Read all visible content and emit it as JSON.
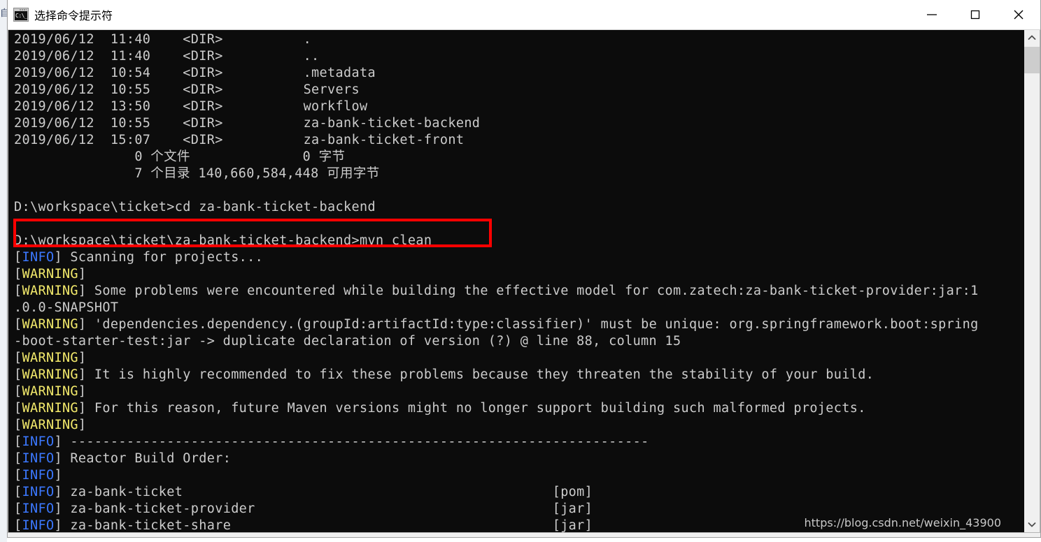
{
  "desktop": {
    "edge_text": "自"
  },
  "window": {
    "title": "选择命令提示符",
    "icon": "cmd-prompt-icon",
    "icon_glyph": "C:\\_",
    "controls": {
      "minimize": "minimize-icon",
      "maximize": "maximize-icon",
      "close": "close-icon"
    }
  },
  "colors": {
    "terminal_bg": "#0c0c0c",
    "terminal_fg": "#cccccc",
    "info_blue": "#3b78ff",
    "warning_yellow": "#f2e96b",
    "annotation_red": "#ff0000",
    "titlebar_bg": "#ffffff",
    "window_chrome": "#f0f0f0"
  },
  "annotation": {
    "type": "red-rectangle-highlight",
    "highlighted_line": "D:\\workspace\\ticket\\za-bank-ticket-backend>mvn clean"
  },
  "watermark": {
    "text": "https://blog.csdn.net/weixin_43900"
  },
  "scrollbar": {
    "up_arrow": "chevron-up-icon",
    "down_arrow": "chevron-down-icon"
  },
  "terminal": {
    "lines": [
      [
        {
          "t": "2019/06/12  11:40    <DIR>          .",
          "c": "c-white"
        }
      ],
      [
        {
          "t": "2019/06/12  11:40    <DIR>          ..",
          "c": "c-white"
        }
      ],
      [
        {
          "t": "2019/06/12  10:54    <DIR>          .metadata",
          "c": "c-white"
        }
      ],
      [
        {
          "t": "2019/06/12  10:55    <DIR>          Servers",
          "c": "c-white"
        }
      ],
      [
        {
          "t": "2019/06/12  13:50    <DIR>          workflow",
          "c": "c-white"
        }
      ],
      [
        {
          "t": "2019/06/12  10:55    <DIR>          za-bank-ticket-backend",
          "c": "c-white"
        }
      ],
      [
        {
          "t": "2019/06/12  15:07    <DIR>          za-bank-ticket-front",
          "c": "c-white"
        }
      ],
      [
        {
          "t": "               0 个文件              0 字节",
          "c": "c-white"
        }
      ],
      [
        {
          "t": "               7 个目录 140,660,584,448 可用字节",
          "c": "c-white"
        }
      ],
      [
        {
          "t": "",
          "c": "c-white"
        }
      ],
      [
        {
          "t": "D:\\workspace\\ticket>cd za-bank-ticket-backend",
          "c": "c-white"
        }
      ],
      [
        {
          "t": "",
          "c": "c-white"
        }
      ],
      [
        {
          "t": "D:\\workspace\\ticket\\za-bank-ticket-backend>mvn clean",
          "c": "c-white"
        }
      ],
      [
        {
          "t": "[",
          "c": "c-white"
        },
        {
          "t": "INFO",
          "c": "c-info"
        },
        {
          "t": "] Scanning for projects...",
          "c": "c-white"
        }
      ],
      [
        {
          "t": "[",
          "c": "c-white"
        },
        {
          "t": "WARNING",
          "c": "c-warn"
        },
        {
          "t": "]",
          "c": "c-white"
        }
      ],
      [
        {
          "t": "[",
          "c": "c-white"
        },
        {
          "t": "WARNING",
          "c": "c-warn"
        },
        {
          "t": "] Some problems were encountered while building the effective model for com.zatech:za-bank-ticket-provider:jar:1",
          "c": "c-white"
        }
      ],
      [
        {
          "t": ".0.0-SNAPSHOT",
          "c": "c-white"
        }
      ],
      [
        {
          "t": "[",
          "c": "c-white"
        },
        {
          "t": "WARNING",
          "c": "c-warn"
        },
        {
          "t": "] 'dependencies.dependency.(groupId:artifactId:type:classifier)' must be unique: org.springframework.boot:spring",
          "c": "c-white"
        }
      ],
      [
        {
          "t": "-boot-starter-test:jar -> duplicate declaration of version (?) @ line 88, column 15",
          "c": "c-white"
        }
      ],
      [
        {
          "t": "[",
          "c": "c-white"
        },
        {
          "t": "WARNING",
          "c": "c-warn"
        },
        {
          "t": "]",
          "c": "c-white"
        }
      ],
      [
        {
          "t": "[",
          "c": "c-white"
        },
        {
          "t": "WARNING",
          "c": "c-warn"
        },
        {
          "t": "] It is highly recommended to fix these problems because they threaten the stability of your build.",
          "c": "c-white"
        }
      ],
      [
        {
          "t": "[",
          "c": "c-white"
        },
        {
          "t": "WARNING",
          "c": "c-warn"
        },
        {
          "t": "]",
          "c": "c-white"
        }
      ],
      [
        {
          "t": "[",
          "c": "c-white"
        },
        {
          "t": "WARNING",
          "c": "c-warn"
        },
        {
          "t": "] For this reason, future Maven versions might no longer support building such malformed projects.",
          "c": "c-white"
        }
      ],
      [
        {
          "t": "[",
          "c": "c-white"
        },
        {
          "t": "WARNING",
          "c": "c-warn"
        },
        {
          "t": "]",
          "c": "c-white"
        }
      ],
      [
        {
          "t": "[",
          "c": "c-white"
        },
        {
          "t": "INFO",
          "c": "c-info"
        },
        {
          "t": "] ------------------------------------------------------------------------",
          "c": "c-white"
        }
      ],
      [
        {
          "t": "[",
          "c": "c-white"
        },
        {
          "t": "INFO",
          "c": "c-info"
        },
        {
          "t": "] Reactor Build Order:",
          "c": "c-white"
        }
      ],
      [
        {
          "t": "[",
          "c": "c-white"
        },
        {
          "t": "INFO",
          "c": "c-info"
        },
        {
          "t": "]",
          "c": "c-white"
        }
      ],
      [
        {
          "t": "[",
          "c": "c-white"
        },
        {
          "t": "INFO",
          "c": "c-info"
        },
        {
          "t": "] za-bank-ticket                                              [pom]",
          "c": "c-white"
        }
      ],
      [
        {
          "t": "[",
          "c": "c-white"
        },
        {
          "t": "INFO",
          "c": "c-info"
        },
        {
          "t": "] za-bank-ticket-provider                                     [jar]",
          "c": "c-white"
        }
      ],
      [
        {
          "t": "[",
          "c": "c-white"
        },
        {
          "t": "INFO",
          "c": "c-info"
        },
        {
          "t": "] za-bank-ticket-share                                        [jar]",
          "c": "c-white"
        }
      ]
    ]
  }
}
